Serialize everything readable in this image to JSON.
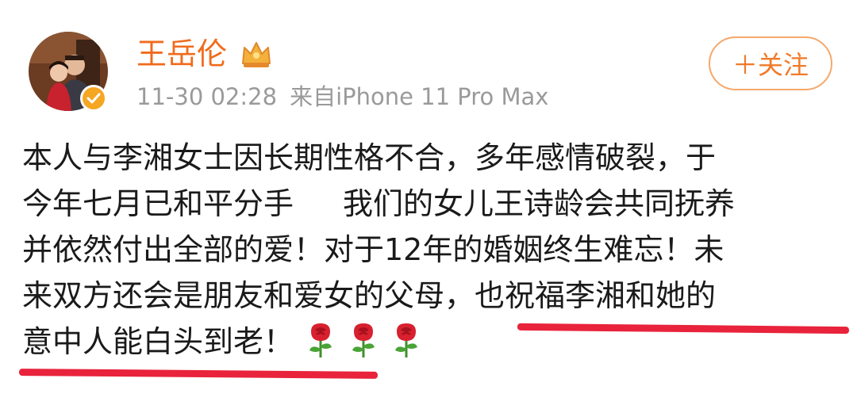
{
  "post": {
    "author": {
      "name": "王岳伦",
      "avatar_icon": "avatar-photo",
      "verified_icon": "verified-check-icon",
      "vip_icon": "crown-icon"
    },
    "meta": {
      "time": "11-30 02:28",
      "source": "来自iPhone 11 Pro Max"
    },
    "follow_label": "＋关注",
    "content_lines": [
      "本人与李湘女士因长期性格不合，多年感情破裂，于",
      "今年七月已和平分手",
      "我们的女儿王诗龄会共同抚养",
      "并依然付出全部的爱！对于12年的婚姻终生难忘！未",
      "来双方还会是朋友和爱女的父母，也祝福李湘和她的",
      "意中人能白头到老！"
    ],
    "emoji": [
      "rose-icon",
      "rose-icon",
      "rose-icon"
    ],
    "colors": {
      "name": "#f06b1c",
      "meta": "#9a9a9a",
      "follow": "#f07a2a",
      "underline": "#e8233b"
    }
  }
}
